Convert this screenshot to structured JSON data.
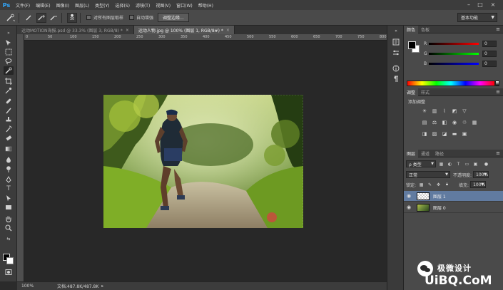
{
  "app": {
    "logo": "Ps"
  },
  "menu": [
    "文件(F)",
    "编辑(E)",
    "图像(I)",
    "图层(L)",
    "类型(Y)",
    "选择(S)",
    "滤镜(T)",
    "视图(V)",
    "窗口(W)",
    "帮助(H)"
  ],
  "window_controls": [
    "–",
    "□",
    "×"
  ],
  "options": {
    "brush_size": "30",
    "sample_all_layers": "对所有图层取样",
    "auto_enhance": "自动增强",
    "refine_edge": "调整边缘...",
    "workspace": "基本功能"
  },
  "doc_tabs": [
    {
      "title": "运动MOTION海报.psd @ 33.3% (图层 3, RGB/8) *",
      "close": "×",
      "active": false
    },
    {
      "title": "运动人物.jpg @ 100% (图层 1, RGB/8#) *",
      "close": "×",
      "active": true
    }
  ],
  "ruler_top": [
    "0",
    "50",
    "100",
    "150",
    "200",
    "250",
    "300",
    "350",
    "400",
    "450",
    "500",
    "550",
    "600",
    "650",
    "700",
    "750",
    "800"
  ],
  "status": {
    "zoom": "100%",
    "doc_size": "文档:487.8K/487.8K"
  },
  "color_panel": {
    "tabs": [
      "颜色",
      "色板"
    ],
    "r_label": "R",
    "g_label": "G",
    "b_label": "B",
    "r": "0",
    "g": "0",
    "b": "0"
  },
  "adjustments_panel": {
    "tabs": [
      "调整",
      "样式"
    ],
    "title": "添加调整"
  },
  "layers_panel": {
    "tabs": [
      "图层",
      "通道",
      "路径"
    ],
    "filter_kind": "ρ 类型",
    "blend_mode": "正常",
    "opacity_label": "不透明度:",
    "opacity": "100%",
    "lock_label": "锁定:",
    "fill_label": "填充:",
    "fill": "100%",
    "layers": [
      {
        "name": "图层 1",
        "selected": true
      },
      {
        "name": "图层 0",
        "selected": false
      }
    ]
  },
  "watermark": {
    "brand": "极微设计",
    "url": "UiBQ.CoM"
  }
}
